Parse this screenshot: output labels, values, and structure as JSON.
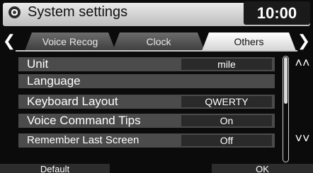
{
  "header": {
    "title": "System settings",
    "time": "10:00"
  },
  "tabs": [
    {
      "label": "Voice Recog"
    },
    {
      "label": "Clock"
    },
    {
      "label": "Others"
    }
  ],
  "settings": [
    {
      "label": "Unit",
      "value": "mile"
    },
    {
      "label": "Language",
      "value": ""
    },
    {
      "label": "Keyboard Layout",
      "value": "QWERTY"
    },
    {
      "label": "Voice Command Tips",
      "value": "On"
    },
    {
      "label": "Remember Last Screen",
      "value": "Off"
    }
  ],
  "buttons": {
    "default": "Default",
    "ok": "OK"
  },
  "icons": {
    "settings": "gear-icon",
    "prev": "chevron-left-icon",
    "next": "chevron-right-icon",
    "scroll_up": "double-chevron-up-icon",
    "scroll_down": "double-chevron-down-icon"
  },
  "colors": {
    "active_tab": "#ffffff",
    "row_bg": "#4b4b4b",
    "value_bg": "#2a2a2a"
  }
}
